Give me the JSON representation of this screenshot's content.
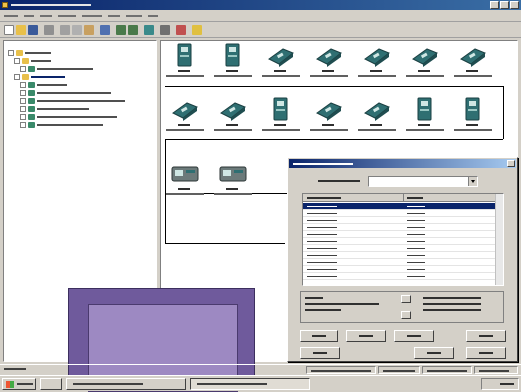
{
  "window": {
    "title_bar_color": "#0a246a",
    "caption_buttons": [
      "minimize-icon",
      "maximize-icon",
      "close-icon"
    ]
  },
  "menu": {
    "item_count": 8
  },
  "toolbar": {
    "buttons": [
      "new-icon",
      "open-icon",
      "save-icon",
      "print-icon",
      "cut-icon",
      "copy-icon",
      "paste-icon",
      "undo-icon",
      "upload-icon",
      "download-icon",
      "online-icon",
      "zoom-icon",
      "wizard-icon",
      "help-icon"
    ]
  },
  "tree": {
    "selected_index": 2
  },
  "diagram": {
    "row1_devices": [
      "drive-icon",
      "drive-icon",
      "adapter-icon",
      "adapter-icon",
      "adapter-icon",
      "adapter-icon",
      "adapter-icon"
    ],
    "row2_devices": [
      "adapter-icon",
      "adapter-icon",
      "drive-icon",
      "adapter-icon",
      "adapter-icon",
      "drive-icon",
      "drive-icon"
    ],
    "row3_devices": [
      "controller-icon",
      "controller-icon"
    ]
  },
  "dialog": {
    "row_count": 11,
    "selected_row": 0
  },
  "overlay": {
    "fill": "#9d89c2",
    "border": "#6f5a9c"
  },
  "colors": {
    "accent": "#0a246a",
    "face": "#d4d0c8",
    "device": "#2f6f72"
  }
}
